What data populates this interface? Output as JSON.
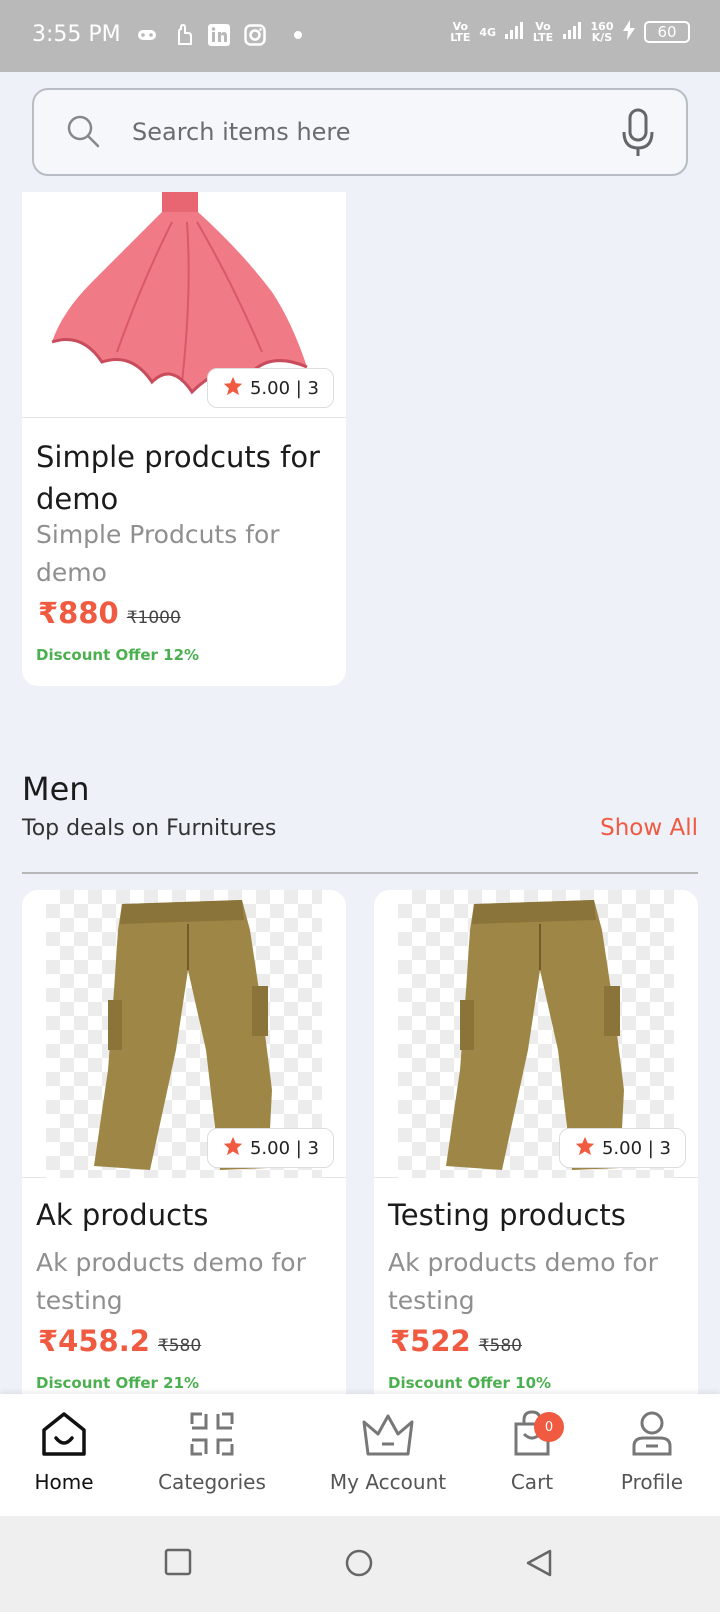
{
  "status_bar": {
    "time": "3:55 PM",
    "network_1": "Vo LTE",
    "network_2": "4G",
    "network_3": "Vo LTE",
    "speed": "160 K/S",
    "battery": "60"
  },
  "search": {
    "placeholder": "Search items here"
  },
  "featured_product": {
    "rating": "5.00 | 3",
    "title": "Simple prodcuts for demo",
    "subtitle": "Simple Prodcuts for demo",
    "price": "₹880",
    "mrp": "₹1000",
    "discount": "Discount Offer 12%"
  },
  "section": {
    "title": "Men",
    "subtitle": "Top deals on Furnitures",
    "show_all": "Show All"
  },
  "products": [
    {
      "rating": "5.00 | 3",
      "title": "Ak products",
      "subtitle": "Ak products demo for testing",
      "price": "₹458.2",
      "mrp": "₹580",
      "discount": "Discount Offer 21%"
    },
    {
      "rating": "5.00 | 3",
      "title": "Testing products",
      "subtitle": "Ak products demo for testing",
      "price": "₹522",
      "mrp": "₹580",
      "discount": "Discount Offer 10%"
    }
  ],
  "bottom_nav": [
    {
      "label": "Home",
      "icon": "home-icon",
      "active": true
    },
    {
      "label": "Categories",
      "icon": "categories-icon"
    },
    {
      "label": "My Account",
      "icon": "crown-icon"
    },
    {
      "label": "Cart",
      "icon": "cart-icon",
      "badge": "0"
    },
    {
      "label": "Profile",
      "icon": "profile-icon"
    }
  ],
  "colors": {
    "accent": "#ef5a40",
    "discount": "#4caf50",
    "background": "#eef2f8"
  }
}
